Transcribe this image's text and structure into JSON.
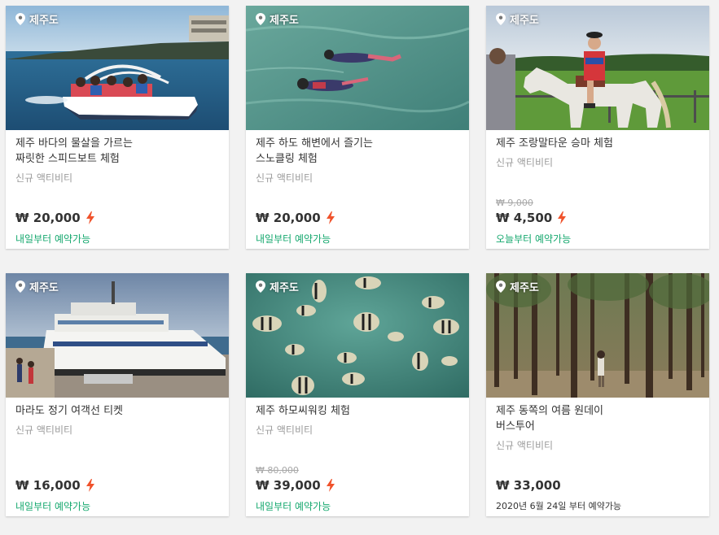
{
  "cards": [
    {
      "location": "제주도",
      "title": "제주 바다의 물살을 가르는\n짜릿한 스피드보트 체험",
      "tag": "신규 액티비티",
      "original_price": "",
      "price": "₩ 20,000",
      "instant": true,
      "availability": "내일부터 예약가능"
    },
    {
      "location": "제주도",
      "title": "제주 하도 해변에서 즐기는\n스노클링 체험",
      "tag": "신규 액티비티",
      "original_price": "",
      "price": "₩ 20,000",
      "instant": true,
      "availability": "내일부터 예약가능"
    },
    {
      "location": "제주도",
      "title": "제주 조랑말타운 승마 체험",
      "tag": "신규 액티비티",
      "original_price": "₩ 9,000",
      "price": "₩ 4,500",
      "instant": true,
      "availability": "오늘부터 예약가능"
    },
    {
      "location": "제주도",
      "title": "마라도 정기 여객선 티켓",
      "tag": "신규 액티비티",
      "original_price": "",
      "price": "₩ 16,000",
      "instant": true,
      "availability": "내일부터 예약가능"
    },
    {
      "location": "제주도",
      "title": "제주 하모씨워킹 체험",
      "tag": "신규 액티비티",
      "original_price": "₩ 80,000",
      "price": "₩ 39,000",
      "instant": true,
      "availability": "내일부터 예약가능"
    },
    {
      "location": "제주도",
      "title": "제주 동쪽의 여름 원데이\n버스투어",
      "tag": "신규 액티비티",
      "original_price": "",
      "price": "₩ 33,000",
      "instant": false,
      "availability": "2020년 6월 24일 부터 예약가능"
    }
  ],
  "colors": {
    "availability": "#15a86e",
    "bolt": "#f0522b",
    "price": "#333333"
  },
  "icons": {
    "location": "map-pin-icon",
    "instant": "lightning-bolt-icon"
  }
}
